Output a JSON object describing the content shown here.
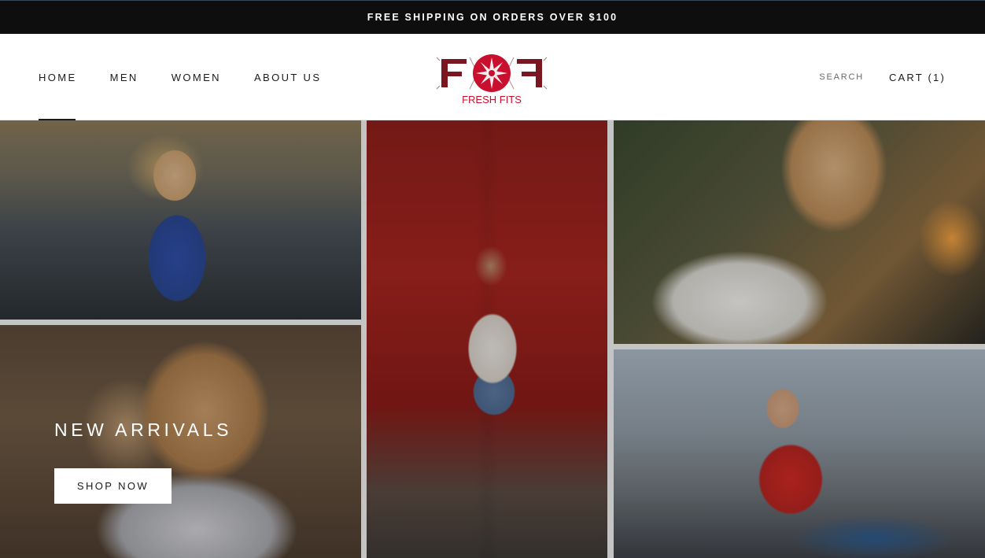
{
  "announcement": {
    "text": "FREE SHIPPING ON ORDERS OVER $100"
  },
  "nav": {
    "items": [
      {
        "label": "HOME",
        "active": true
      },
      {
        "label": "MEN",
        "active": false
      },
      {
        "label": "WOMEN",
        "active": false
      },
      {
        "label": "ABOUT US",
        "active": false
      }
    ]
  },
  "logo": {
    "text": "FRESH FITS",
    "primary_color": "#c8102e",
    "secondary_color": "#7a1620"
  },
  "header_right": {
    "search_label": "SEARCH",
    "cart_label": "CART (1)"
  },
  "hero": {
    "title": "NEW ARRIVALS",
    "button_label": "SHOP NOW"
  },
  "colors": {
    "announcement_bg": "#0e0e0e",
    "text_dark": "#1a1a1a",
    "button_bg": "#ffffff"
  }
}
